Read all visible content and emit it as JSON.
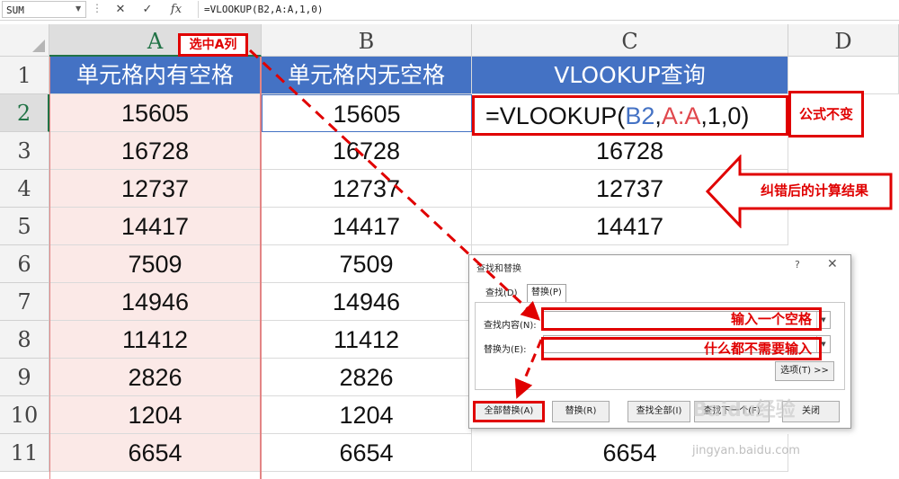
{
  "formula_bar": {
    "name_box": "SUM",
    "cancel_icon": "✕",
    "enter_icon": "✓",
    "fx_icon": "fx",
    "formula": "=VLOOKUP(B2,A:A,1,0)"
  },
  "columns": [
    "A",
    "B",
    "C",
    "D"
  ],
  "rows": [
    "1",
    "2",
    "3",
    "4",
    "5",
    "6",
    "7",
    "8",
    "9",
    "10",
    "11"
  ],
  "headers": {
    "a": "单元格内有空格",
    "b": "单元格内无空格",
    "c": "VLOOKUP查询"
  },
  "table": [
    {
      "a": "15605",
      "b": "15605",
      "c": ""
    },
    {
      "a": "16728",
      "b": "16728",
      "c": "16728"
    },
    {
      "a": "12737",
      "b": "12737",
      "c": "12737"
    },
    {
      "a": "14417",
      "b": "14417",
      "c": "14417"
    },
    {
      "a": "7509",
      "b": "7509",
      "c": ""
    },
    {
      "a": "14946",
      "b": "14946",
      "c": ""
    },
    {
      "a": "11412",
      "b": "11412",
      "c": ""
    },
    {
      "a": "2826",
      "b": "2826",
      "c": ""
    },
    {
      "a": "1204",
      "b": "1204",
      "c": ""
    },
    {
      "a": "6654",
      "b": "6654",
      "c": "6654"
    }
  ],
  "formula_cell": {
    "prefix": "=VLOOKUP(",
    "ref_b": "B2",
    "comma1": ",",
    "ref_a": "A:A",
    "suffix": ",1,0)"
  },
  "annotations": {
    "select_col_a": "选中A列",
    "formula_unchanged": "公式不变",
    "corrected_result": "纠错后的计算结果",
    "enter_space": "输入一个空格",
    "enter_nothing": "什么都不需要输入"
  },
  "dialog": {
    "title": "查找和替换",
    "help": "?",
    "close": "✕",
    "tab_find": "查找(D)",
    "tab_replace": "替换(P)",
    "find_label": "查找内容(N):",
    "replace_label": "替换为(E):",
    "options_button": "选项(T) >>",
    "replace_all_button": "全部替换(A)",
    "replace_button": "替换(R)",
    "find_all_button": "查找全部(I)",
    "find_next_button": "查找下一个(F)",
    "close_button": "关闭"
  },
  "watermark": {
    "logo": "Baidu经验",
    "url": "jingyan.baidu.com"
  },
  "colors": {
    "header_blue": "#4472c4",
    "annotation_red": "#e00000",
    "excel_green": "#217346",
    "col_a_fill": "#fbe9e7"
  }
}
